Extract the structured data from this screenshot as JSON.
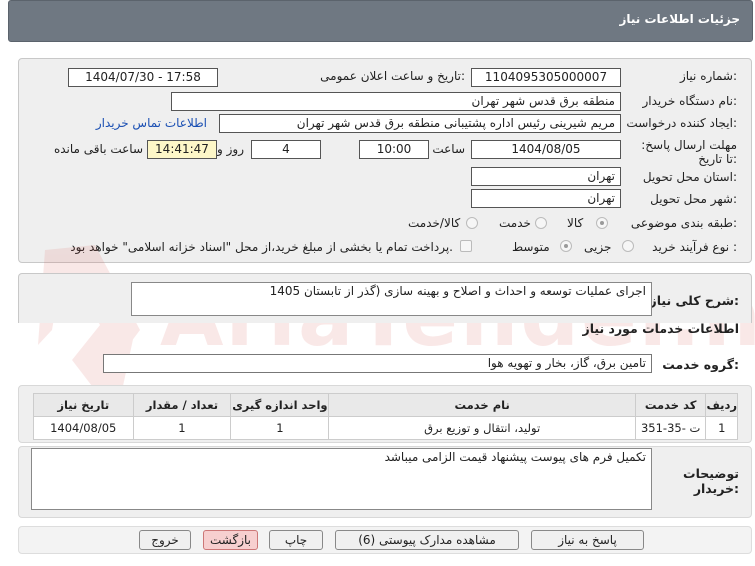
{
  "header": {
    "title": "جزئیات اطلاعات نیاز"
  },
  "form": {
    "need_number_label": "شماره نیاز:",
    "need_number": "1104095305000007",
    "announce_label": "تاریخ و ساعت اعلان عمومی:",
    "announce_value": "1404/07/30 - 17:58",
    "buyer_org_label": "نام دستگاه خریدار:",
    "buyer_org": "منطقه برق قدس شهر تهران",
    "creator_label": "ایجاد کننده درخواست:",
    "creator": "مریم شیرینی رئیس اداره پشتیبانی منطقه برق قدس شهر تهران",
    "contact_link": "اطلاعات تماس خریدار",
    "deadline_label": "مهلت ارسال پاسخ: تا تاریخ:",
    "deadline_date": "1404/08/05",
    "hour_label": "ساعت",
    "deadline_time": "10:00",
    "days_value": "4",
    "days_label": "روز و",
    "remaining_time": "14:41:47",
    "remaining_label": "ساعت باقی مانده",
    "province_label": "استان محل تحویل:",
    "province": "تهران",
    "city_label": "شهر محل تحویل:",
    "city": "تهران",
    "category_label": "طبقه بندی موضوعی:",
    "category_options": [
      "کالا",
      "خدمت",
      "کالا/خدمت"
    ],
    "process_label": "نوع فرآیند خرید :",
    "process_options": [
      "جزیی",
      "متوسط"
    ],
    "payment_note": "پرداخت تمام یا بخشی از مبلغ خرید،از محل \"اسناد خزانه اسلامی\" خواهد بود."
  },
  "description": {
    "label": "شرح کلی نیاز:",
    "value": "اجرای عملیات توسعه و احداث و اصلاح و بهینه سازی (گذر از تابستان 1405"
  },
  "services": {
    "section_title": "اطلاعات خدمات مورد نیاز",
    "group_label": "گروه خدمت:",
    "group_value": "تامین برق، گاز، بخار و تهویه هوا",
    "table": {
      "headers": [
        "ردیف",
        "کد خدمت",
        "نام خدمت",
        "واحد اندازه گیری",
        "تعداد / مقدار",
        "تاریخ نیاز"
      ],
      "rows": [
        [
          "1",
          "ت -35-351",
          "تولید، انتقال و توزیع برق",
          "1",
          "1",
          "1404/08/05"
        ]
      ]
    }
  },
  "buyer_notes": {
    "label_line1": "توضیحات",
    "label_line2": "خریدار:",
    "value": "تکمیل  فرم های پیوست پیشنهاد قیمت الزامی میباشد"
  },
  "buttons": {
    "reply": "پاسخ به نیاز",
    "attachments": "مشاهده مدارک پیوستی (6)",
    "print": "چاپ",
    "back": "بازگشت",
    "exit": "خروج"
  },
  "watermark": {
    "text": "AriaTender.net",
    "color": "#d9534f"
  }
}
